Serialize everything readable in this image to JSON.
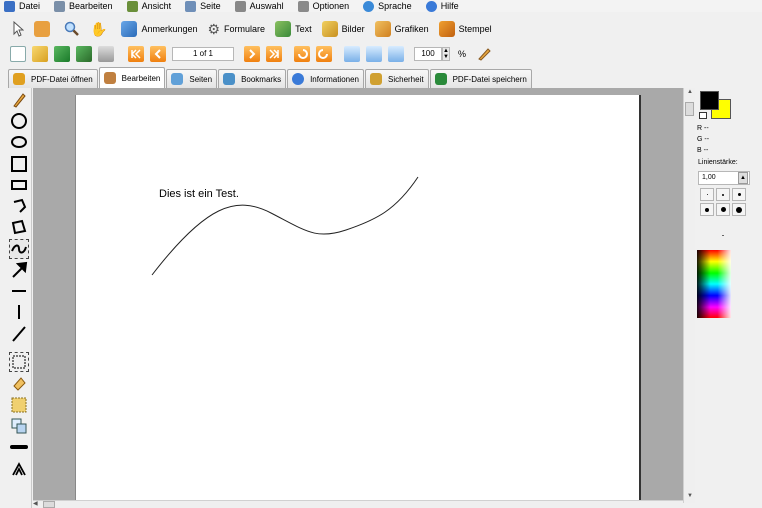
{
  "menu": [
    {
      "label": "Datei",
      "icon": "document-icon",
      "color": "#3a6fc4"
    },
    {
      "label": "Bearbeiten",
      "icon": "pen-icon",
      "color": "#7a8fa8"
    },
    {
      "label": "Ansicht",
      "icon": "eye-icon",
      "color": "#6a8f3a"
    },
    {
      "label": "Seite",
      "icon": "book-icon",
      "color": "#6f8fb8"
    },
    {
      "label": "Auswahl",
      "icon": "cursor-icon",
      "color": "#888888"
    },
    {
      "label": "Optionen",
      "icon": "wrench-icon",
      "color": "#8a8a8a"
    },
    {
      "label": "Sprache",
      "icon": "globe-icon",
      "color": "#3a8ad8"
    },
    {
      "label": "Hilfe",
      "icon": "help-icon",
      "color": "#3a7ad8"
    }
  ],
  "toolbar1": {
    "annotations": "Anmerkungen",
    "forms": "Formulare",
    "text": "Text",
    "images": "Bilder",
    "graphics": "Grafiken",
    "stamp": "Stempel"
  },
  "toolbar2": {
    "page_value": "1 of 1",
    "zoom_value": "100",
    "zoom_unit": "%"
  },
  "tabs": [
    {
      "label": "PDF-Datei öffnen",
      "icon": "folder-open-icon",
      "color": "#e0a020"
    },
    {
      "label": "Bearbeiten",
      "icon": "edit-icon",
      "color": "#c08040",
      "active": true
    },
    {
      "label": "Seiten",
      "icon": "pages-icon",
      "color": "#60a0d8"
    },
    {
      "label": "Bookmarks",
      "icon": "bookmarks-icon",
      "color": "#4a90c8"
    },
    {
      "label": "Informationen",
      "icon": "info-icon",
      "color": "#3a7ad8"
    },
    {
      "label": "Sicherheit",
      "icon": "key-icon",
      "color": "#d0a030"
    },
    {
      "label": "PDF-Datei speichern",
      "icon": "save-icon",
      "color": "#2a8a3a"
    }
  ],
  "document": {
    "text": "Dies ist ein Test."
  },
  "right_panel": {
    "fg_color": "#000000",
    "bg_color": "#ffff00",
    "r_label": "R --",
    "g_label": "G --",
    "b_label": "B --",
    "line_width_label": "Linienstärke:",
    "line_width_value": "1,00"
  }
}
